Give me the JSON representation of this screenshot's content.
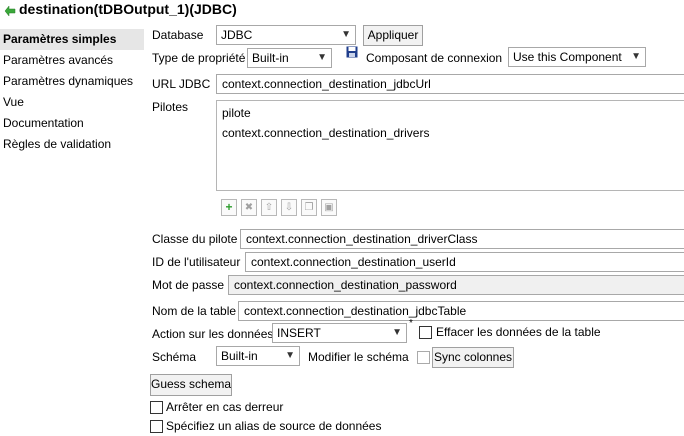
{
  "window": {
    "title": "destination(tDBOutput_1)(JDBC)",
    "icon": "component-icon"
  },
  "sidebar": {
    "items": [
      {
        "label": "Paramètres simples",
        "active": true
      },
      {
        "label": "Paramètres avancés",
        "active": false
      },
      {
        "label": "Paramètres dynamiques",
        "active": false
      },
      {
        "label": "Vue",
        "active": false
      },
      {
        "label": "Documentation",
        "active": false
      },
      {
        "label": "Règles de validation",
        "active": false
      }
    ]
  },
  "form": {
    "database_label": "Database",
    "database_value": "JDBC",
    "apply_label": "Appliquer",
    "property_type_label": "Type de propriété",
    "property_type_value": "Built-in",
    "save_icon": "floppy-disk-icon",
    "connection_component_label": "Composant de connexion",
    "connection_component_value": "Use this Component",
    "jdbc_url_label": "URL JDBC",
    "jdbc_url_value": "context.connection_destination_jdbcUrl",
    "drivers_label": "Pilotes",
    "drivers_list": [
      "pilote",
      "context.connection_destination_drivers"
    ],
    "driver_class_label": "Classe du pilote",
    "driver_class_value": "context.connection_destination_driverClass",
    "user_id_label": "ID de l'utilisateur",
    "user_id_value": "context.connection_destination_userId",
    "password_label": "Mot de passe",
    "password_value": "context.connection_destination_password",
    "table_name_label": "Nom de la table",
    "table_name_value": "context.connection_destination_jdbcTable",
    "data_action_label": "Action sur les données",
    "data_action_value": "INSERT",
    "required_marker": "*",
    "clear_table_label": "Effacer les données de la table",
    "schema_label": "Schéma",
    "schema_value": "Built-in",
    "edit_schema_label": "Modifier le schéma",
    "sync_columns_label": "Sync colonnes",
    "guess_schema_label": "Guess schema",
    "stop_on_error_label": "Arrêter en cas derreur",
    "datasource_alias_label": "Spécifiez un alias de source de données"
  },
  "colors": {
    "sidebar_active_bg": "#e6e6e6",
    "add_button": "#2e9e2e",
    "save_icon": "#1f3e8c"
  }
}
